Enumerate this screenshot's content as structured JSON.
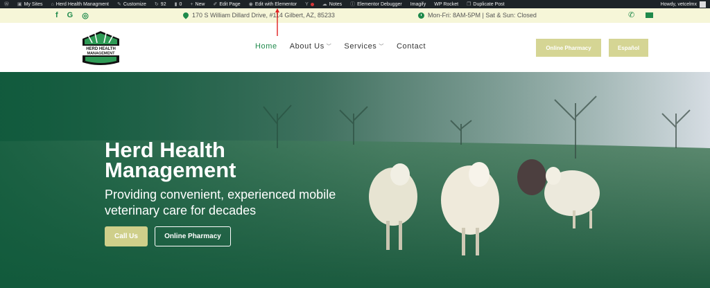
{
  "adminbar": {
    "items": [
      {
        "icon": "wordpress-icon",
        "label": ""
      },
      {
        "icon": "sites-icon",
        "label": "My Sites"
      },
      {
        "icon": "home-icon",
        "label": "Herd Health Managment"
      },
      {
        "icon": "brush-icon",
        "label": "Customize"
      },
      {
        "icon": "updates-icon",
        "label": "92"
      },
      {
        "icon": "comment-icon",
        "label": "0"
      },
      {
        "icon": "plus-icon",
        "label": "New"
      },
      {
        "icon": "pencil-icon",
        "label": "Edit Page"
      },
      {
        "icon": "elementor-icon",
        "label": "Edit with Elementor"
      },
      {
        "icon": "yoast-icon",
        "label": ""
      },
      {
        "icon": "status-dot-icon",
        "label": ""
      },
      {
        "icon": "notes-icon",
        "label": "Notes"
      },
      {
        "icon": "info-icon",
        "label": "Elementor Debugger"
      },
      {
        "icon": "",
        "label": "Imagify"
      },
      {
        "icon": "",
        "label": "WP Rocket"
      },
      {
        "icon": "duplicate-icon",
        "label": "Duplicate Post"
      }
    ],
    "howdy": "Howdy, vetcelmx"
  },
  "topbar": {
    "address": "170 S William Dillard Drive, #114 Gilbert, AZ, 85233",
    "hours": "Mon-Fri: 8AM-5PM | Sat & Sun: Closed",
    "social": [
      "f",
      "G",
      "◎"
    ],
    "accent": "#1f8a4c"
  },
  "header": {
    "logo_text": "HERD HEALTH MANAGEMENT",
    "nav": [
      {
        "label": "Home",
        "active": true
      },
      {
        "label": "About Us",
        "dropdown": true
      },
      {
        "label": "Services",
        "dropdown": true
      },
      {
        "label": "Contact"
      }
    ],
    "btn_pharmacy": "Online Pharmacy",
    "btn_espanol": "Español"
  },
  "hero": {
    "title": "Herd Health Management",
    "subtitle": "Providing convenient, experienced mobile veterinary care for decades",
    "btn_call": "Call Us",
    "btn_pharmacy": "Online Pharmacy"
  }
}
